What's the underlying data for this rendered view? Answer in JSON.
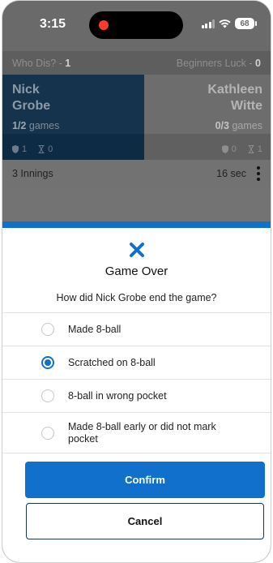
{
  "status_bar": {
    "time": "3:15",
    "battery": "68"
  },
  "teams": {
    "left_name": "Who Dis?",
    "left_score": "1",
    "right_name": "Beginners Luck",
    "right_score": "0"
  },
  "players": {
    "left": {
      "first": "Nick",
      "last": "Grobe",
      "games_value": "1/2",
      "games_suffix": " games",
      "stat_a": "1",
      "stat_b": "0"
    },
    "right": {
      "first": "Kathleen",
      "last": "Witte",
      "games_value": "0/3",
      "games_suffix": " games",
      "stat_a": "0",
      "stat_b": "1"
    }
  },
  "match": {
    "innings": "3 Innings",
    "elapsed": "16 sec"
  },
  "dialog": {
    "title": "Game Over",
    "question": "How did Nick Grobe end the game?",
    "options": [
      {
        "label": "Made 8-ball",
        "selected": false
      },
      {
        "label": "Scratched on 8-ball",
        "selected": true
      },
      {
        "label": "8-ball in wrong pocket",
        "selected": false
      },
      {
        "label": "Made 8-ball early or did not mark pocket",
        "selected": false
      }
    ],
    "confirm_label": "Confirm",
    "cancel_label": "Cancel"
  },
  "colors": {
    "accent": "#1170cc",
    "header_dark": "#15334d"
  }
}
